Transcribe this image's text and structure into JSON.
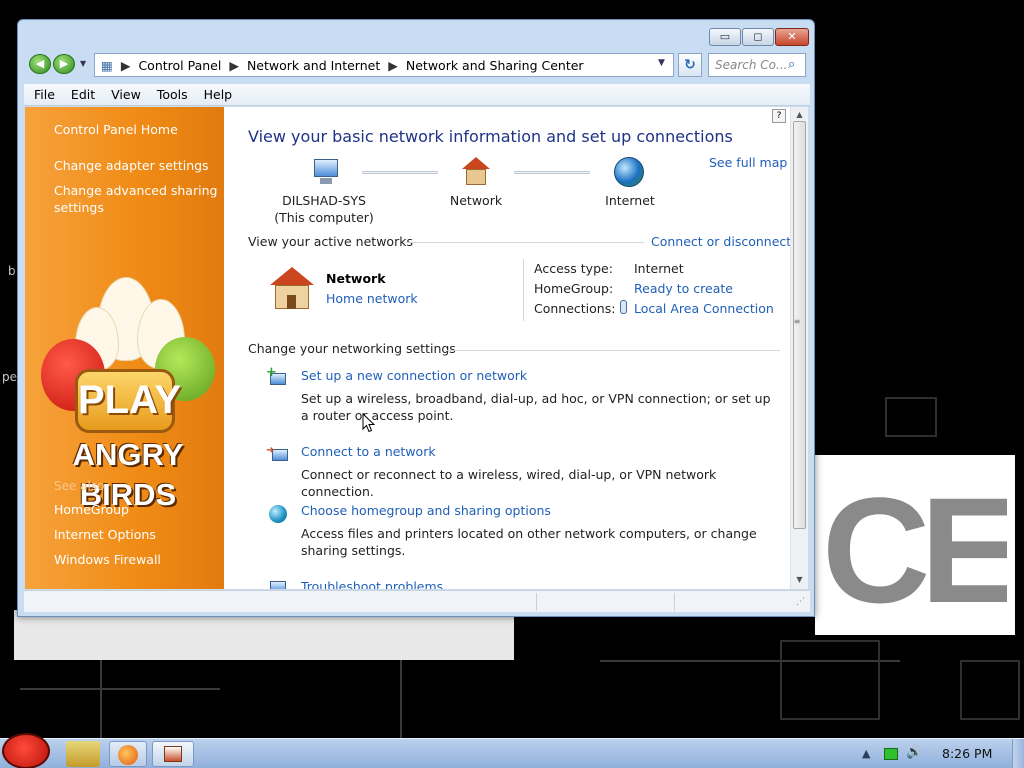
{
  "window": {
    "controls": {
      "minimize": "▭",
      "maximize": "◻",
      "close": "✕"
    }
  },
  "address": {
    "breadcrumbs": [
      "Control Panel",
      "Network and Internet",
      "Network and Sharing Center"
    ],
    "search_placeholder": "Search Co..."
  },
  "menu": [
    "File",
    "Edit",
    "View",
    "Tools",
    "Help"
  ],
  "sidebar": {
    "home_link": "Control Panel Home",
    "links": [
      "Change adapter settings",
      "Change advanced sharing settings"
    ],
    "promo": {
      "play_text": "PLAY",
      "logo_text": "ANGRY BIRDS"
    },
    "see_also_heading": "See also",
    "see_also_links": [
      "HomeGroup",
      "Internet Options",
      "Windows Firewall"
    ]
  },
  "content": {
    "title": "View your basic network information and set up connections",
    "see_full_map": "See full map",
    "network_map": {
      "computer_name": "DILSHAD-SYS",
      "computer_sub": "(This computer)",
      "network_label": "Network",
      "internet_label": "Internet"
    },
    "active_networks": {
      "heading": "View your active networks",
      "connect_link": "Connect or disconnect",
      "network_name": "Network",
      "network_type": "Home network",
      "access_type_label": "Access type:",
      "access_type_value": "Internet",
      "homegroup_label": "HomeGroup:",
      "homegroup_value": "Ready to create",
      "connections_label": "Connections:",
      "connections_value": "Local Area Connection"
    },
    "settings": {
      "heading": "Change your networking settings",
      "tasks": [
        {
          "title": "Set up a new connection or network",
          "desc": "Set up a wireless, broadband, dial-up, ad hoc, or VPN connection; or set up a router or access point."
        },
        {
          "title": "Connect to a network",
          "desc": "Connect or reconnect to a wireless, wired, dial-up, or VPN network connection."
        },
        {
          "title": "Choose homegroup and sharing options",
          "desc": "Access files and printers located on other network computers, or change sharing settings."
        },
        {
          "title": "Troubleshoot problems",
          "desc": ""
        }
      ]
    }
  },
  "desktop": {
    "edge_text_1": "b",
    "edge_text_2": "pe",
    "logo_text": "CE"
  },
  "taskbar": {
    "clock": "8:26 PM"
  }
}
